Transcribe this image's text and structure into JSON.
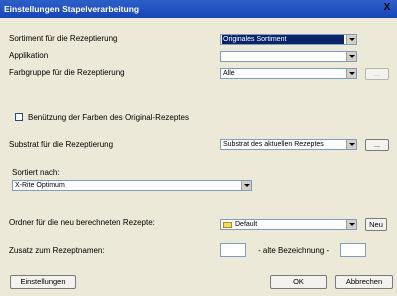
{
  "window": {
    "title": "Einstellungen Stapelverarbeitung",
    "close": "X"
  },
  "rows": {
    "sortiment": {
      "label": "Sortiment für die Rezeptierung",
      "value": "Originales Sortiment"
    },
    "applikation": {
      "label": "Applikation",
      "value": ""
    },
    "farbgruppe": {
      "label": "Farbgruppe für die Rezeptierung",
      "value": "Alle",
      "button": "..."
    },
    "benutzung": {
      "label": "Benützung der Farben des Original-Rezeptes",
      "checked": false
    },
    "substrat": {
      "label": "Substrat für die Rezeptierung",
      "value": "Substrat des aktuellen Rezeptes",
      "button": "..."
    },
    "sortiert": {
      "label": "Sortiert nach:",
      "value": "X-Rite Optimum"
    },
    "ordner": {
      "label": "Ordner für die neu berechneten Rezepte:",
      "value": "Default",
      "button": "Neu",
      "icon": "folder-icon"
    },
    "zusatz": {
      "label": "Zusatz zum Rezeptnamen:",
      "middle_label": "- alte Bezeichnung -",
      "value1": "",
      "value2": ""
    }
  },
  "buttons": {
    "einstellungen": "Einstellungen",
    "ok": "OK",
    "abbrechen": "Abbrechen"
  }
}
